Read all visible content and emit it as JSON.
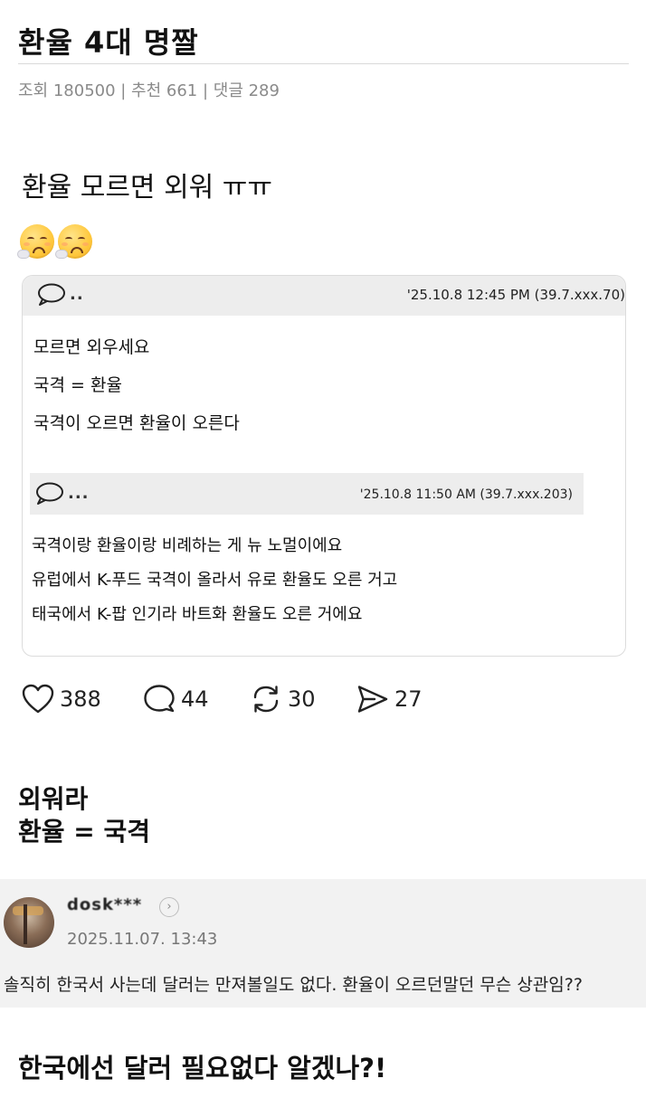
{
  "post": {
    "title": "환율 4대 명짤",
    "meta": "조회 180500 | 추천 661 | 댓글 289"
  },
  "content": {
    "tweet_text": "환율 모르면 외워 ㅠㅠ",
    "emoji_icon": "weary-face-emoji",
    "card": {
      "comment": {
        "dots": "..",
        "stamp": "'25.10.8 12:45 PM (39.7.xxx.70)",
        "lines": [
          "모르면 외우세요",
          "국격 = 환율",
          "국격이 오르면 환율이 오른다"
        ]
      },
      "reply": {
        "dots": "...",
        "stamp": "'25.10.8 11:50 AM (39.7.xxx.203)",
        "lines": [
          "국격이랑 환율이랑 비례하는 게 뉴 노멀이에요",
          "유럽에서 K-푸드 국격이 올라서 유로 환율도 오른 거고",
          "태국에서 K-팝 인기라 바트화 환율도 오른 거에요"
        ]
      }
    },
    "actions": {
      "likes": "388",
      "comments": "44",
      "reposts": "30",
      "shares": "27"
    },
    "caption_lines": [
      "외워라",
      "환율 = 국격"
    ],
    "fb_comment": {
      "nickname": "dosk***",
      "date": "2025.11.07. 13:43",
      "text": "솔직히 한국서 사는데 달러는 만져볼일도 없다. 환율이 오르던말던 무슨 상관임??"
    },
    "final_caption": "한국에선 달러 필요없다 알겠나?!"
  }
}
